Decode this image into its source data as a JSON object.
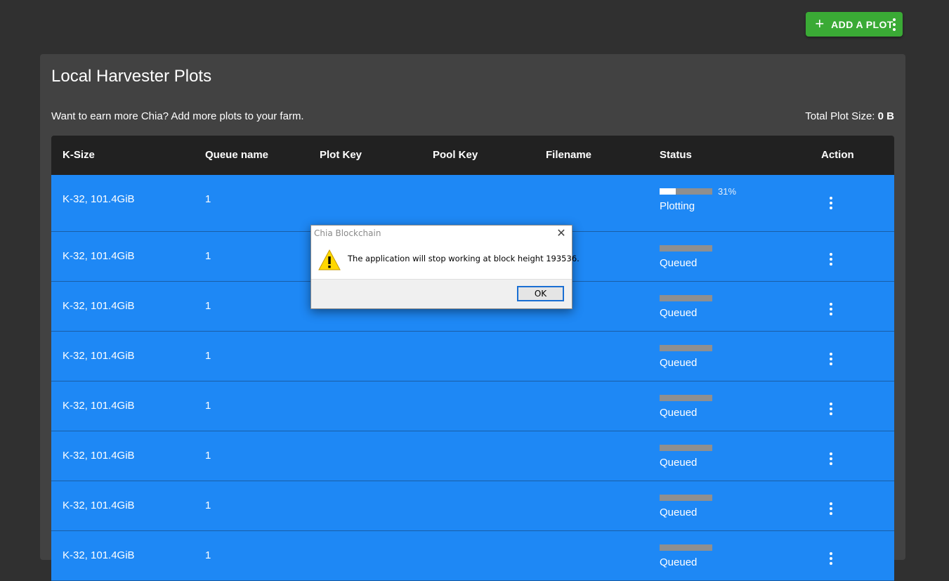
{
  "toolbar": {
    "add_plot_label": "ADD A PLOT",
    "add_plot_icon": "plus-icon",
    "more_icon": "more-vert-icon"
  },
  "card": {
    "title": "Local Harvester Plots",
    "subtitle": "Want to earn more Chia? Add more plots to your farm.",
    "total_label": "Total Plot Size:",
    "total_value": "0 B"
  },
  "table": {
    "headers": [
      "K-Size",
      "Queue name",
      "Plot Key",
      "Pool Key",
      "Filename",
      "Status",
      "Action"
    ],
    "rows": [
      {
        "ksize": "K-32, 101.4GiB",
        "queue": "1",
        "progress": 0.31,
        "progress_label": "31%",
        "status": "Plotting"
      },
      {
        "ksize": "K-32, 101.4GiB",
        "queue": "1",
        "progress": 0,
        "progress_label": "",
        "status": "Queued"
      },
      {
        "ksize": "K-32, 101.4GiB",
        "queue": "1",
        "progress": 0,
        "progress_label": "",
        "status": "Queued"
      },
      {
        "ksize": "K-32, 101.4GiB",
        "queue": "1",
        "progress": 0,
        "progress_label": "",
        "status": "Queued"
      },
      {
        "ksize": "K-32, 101.4GiB",
        "queue": "1",
        "progress": 0,
        "progress_label": "",
        "status": "Queued"
      },
      {
        "ksize": "K-32, 101.4GiB",
        "queue": "1",
        "progress": 0,
        "progress_label": "",
        "status": "Queued"
      },
      {
        "ksize": "K-32, 101.4GiB",
        "queue": "1",
        "progress": 0,
        "progress_label": "",
        "status": "Queued"
      },
      {
        "ksize": "K-32, 101.4GiB",
        "queue": "1",
        "progress": 0,
        "progress_label": "",
        "status": "Queued"
      }
    ]
  },
  "dialog": {
    "title": "Chia Blockchain",
    "message": "The application will stop working at block height 193536.",
    "ok_label": "OK",
    "icon": "warning-icon"
  },
  "colors": {
    "background": "#303030",
    "card": "#424242",
    "header": "#212121",
    "row": "#1e88f5",
    "accent_green": "#3aaa35"
  }
}
